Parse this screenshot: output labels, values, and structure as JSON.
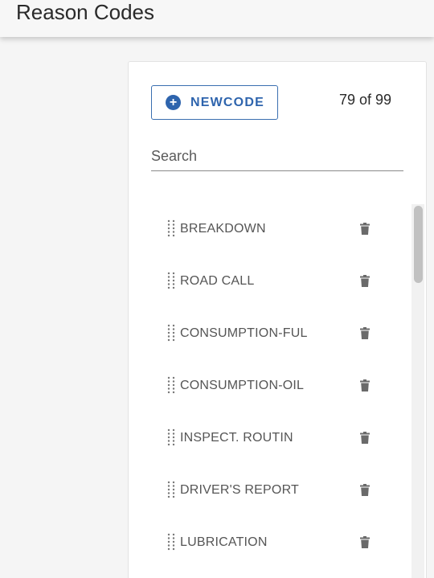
{
  "header": {
    "title": "Reason Codes"
  },
  "toolbar": {
    "new_button_label": "NEWCODE",
    "count_text": "79 of 99"
  },
  "search": {
    "placeholder": "Search",
    "value": ""
  },
  "codes": [
    {
      "label": "BREAKDOWN"
    },
    {
      "label": "ROAD CALL"
    },
    {
      "label": "CONSUMPTION-FUL"
    },
    {
      "label": "CONSUMPTION-OIL"
    },
    {
      "label": "INSPECT. ROUTIN"
    },
    {
      "label": "DRIVER'S REPORT"
    },
    {
      "label": "LUBRICATION"
    }
  ],
  "colors": {
    "accent": "#2e64ad",
    "icon": "#6a6a6a"
  },
  "icons": {
    "add": "plus-circle-icon",
    "drag": "drag-handle-icon",
    "delete": "trash-icon"
  }
}
